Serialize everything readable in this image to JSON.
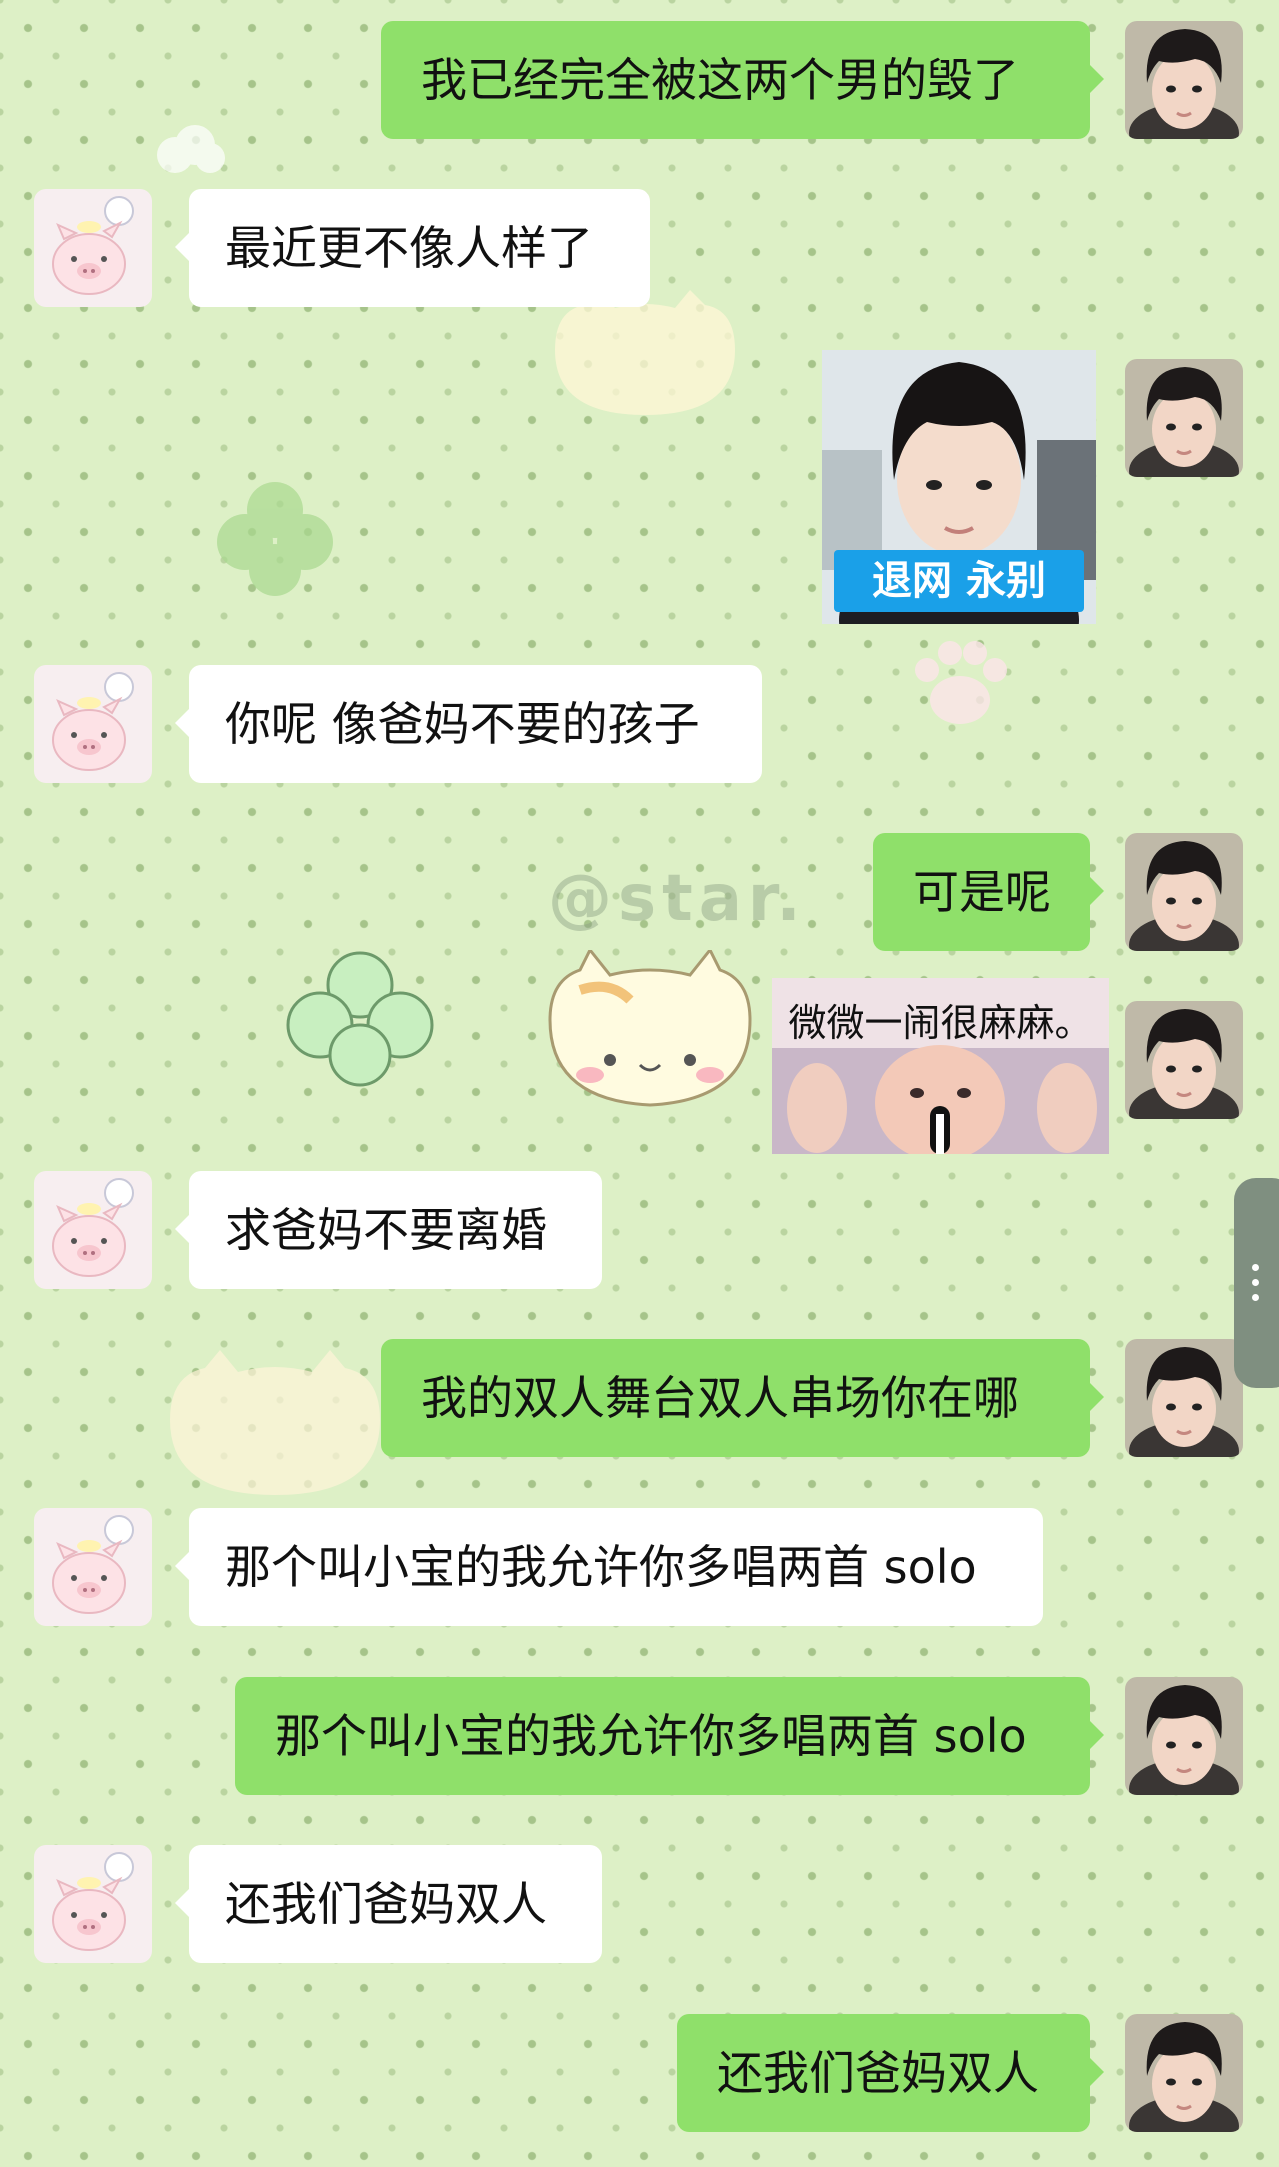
{
  "conversation": [
    {
      "side": "self",
      "type": "text",
      "text": "我已经完全被这两个男的毁了"
    },
    {
      "side": "other",
      "type": "text",
      "text": "最近更不像人样了"
    },
    {
      "side": "self",
      "type": "sticker",
      "caption": "退网 永别"
    },
    {
      "side": "other",
      "type": "text",
      "text": "你呢 像爸妈不要的孩子"
    },
    {
      "side": "self",
      "type": "text",
      "text": "可是呢"
    },
    {
      "side": "self",
      "type": "sticker",
      "caption": "微微一闹很麻麻。"
    },
    {
      "side": "other",
      "type": "text",
      "text": "求爸妈不要离婚"
    },
    {
      "side": "self",
      "type": "text",
      "text": "我的双人舞台双人串场你在哪"
    },
    {
      "side": "other",
      "type": "text",
      "text": "那个叫小宝的我允许你多唱两首 solo"
    },
    {
      "side": "self",
      "type": "text",
      "text": "那个叫小宝的我允许你多唱两首 solo"
    },
    {
      "side": "other",
      "type": "text",
      "text": "还我们爸妈双人"
    },
    {
      "side": "self",
      "type": "text",
      "text": "还我们爸妈双人"
    }
  ],
  "watermark": "@star.",
  "colors": {
    "background": "#ddf0c6",
    "self_bubble": "#8fe06a",
    "other_bubble": "#ffffff",
    "sticker_tag": "#1aa0e8"
  },
  "icons": {
    "self_avatar": "boy-portrait-avatar",
    "other_avatar": "pig-cartoon-avatar",
    "scroll_handle": "more-vertical-icon"
  }
}
